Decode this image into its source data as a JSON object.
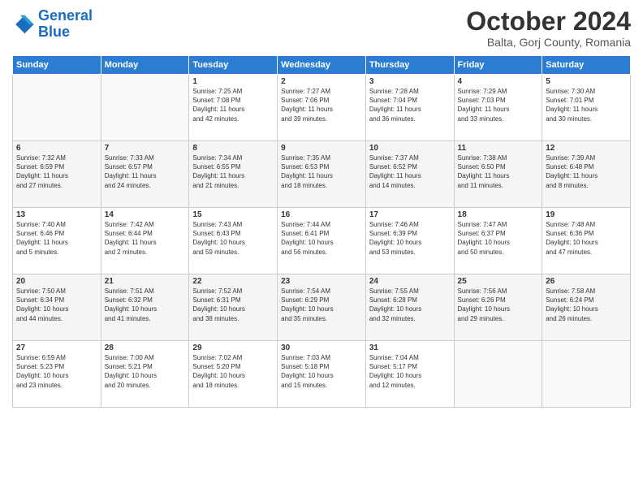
{
  "header": {
    "logo_line1": "General",
    "logo_line2": "Blue",
    "title": "October 2024",
    "subtitle": "Balta, Gorj County, Romania"
  },
  "days_of_week": [
    "Sunday",
    "Monday",
    "Tuesday",
    "Wednesday",
    "Thursday",
    "Friday",
    "Saturday"
  ],
  "weeks": [
    [
      {
        "day": "",
        "sunrise": "",
        "sunset": "",
        "daylight": ""
      },
      {
        "day": "",
        "sunrise": "",
        "sunset": "",
        "daylight": ""
      },
      {
        "day": "1",
        "sunrise": "Sunrise: 7:25 AM",
        "sunset": "Sunset: 7:08 PM",
        "daylight": "Daylight: 11 hours and 42 minutes."
      },
      {
        "day": "2",
        "sunrise": "Sunrise: 7:27 AM",
        "sunset": "Sunset: 7:06 PM",
        "daylight": "Daylight: 11 hours and 39 minutes."
      },
      {
        "day": "3",
        "sunrise": "Sunrise: 7:28 AM",
        "sunset": "Sunset: 7:04 PM",
        "daylight": "Daylight: 11 hours and 36 minutes."
      },
      {
        "day": "4",
        "sunrise": "Sunrise: 7:29 AM",
        "sunset": "Sunset: 7:03 PM",
        "daylight": "Daylight: 11 hours and 33 minutes."
      },
      {
        "day": "5",
        "sunrise": "Sunrise: 7:30 AM",
        "sunset": "Sunset: 7:01 PM",
        "daylight": "Daylight: 11 hours and 30 minutes."
      }
    ],
    [
      {
        "day": "6",
        "sunrise": "Sunrise: 7:32 AM",
        "sunset": "Sunset: 6:59 PM",
        "daylight": "Daylight: 11 hours and 27 minutes."
      },
      {
        "day": "7",
        "sunrise": "Sunrise: 7:33 AM",
        "sunset": "Sunset: 6:57 PM",
        "daylight": "Daylight: 11 hours and 24 minutes."
      },
      {
        "day": "8",
        "sunrise": "Sunrise: 7:34 AM",
        "sunset": "Sunset: 6:55 PM",
        "daylight": "Daylight: 11 hours and 21 minutes."
      },
      {
        "day": "9",
        "sunrise": "Sunrise: 7:35 AM",
        "sunset": "Sunset: 6:53 PM",
        "daylight": "Daylight: 11 hours and 18 minutes."
      },
      {
        "day": "10",
        "sunrise": "Sunrise: 7:37 AM",
        "sunset": "Sunset: 6:52 PM",
        "daylight": "Daylight: 11 hours and 14 minutes."
      },
      {
        "day": "11",
        "sunrise": "Sunrise: 7:38 AM",
        "sunset": "Sunset: 6:50 PM",
        "daylight": "Daylight: 11 hours and 11 minutes."
      },
      {
        "day": "12",
        "sunrise": "Sunrise: 7:39 AM",
        "sunset": "Sunset: 6:48 PM",
        "daylight": "Daylight: 11 hours and 8 minutes."
      }
    ],
    [
      {
        "day": "13",
        "sunrise": "Sunrise: 7:40 AM",
        "sunset": "Sunset: 6:46 PM",
        "daylight": "Daylight: 11 hours and 5 minutes."
      },
      {
        "day": "14",
        "sunrise": "Sunrise: 7:42 AM",
        "sunset": "Sunset: 6:44 PM",
        "daylight": "Daylight: 11 hours and 2 minutes."
      },
      {
        "day": "15",
        "sunrise": "Sunrise: 7:43 AM",
        "sunset": "Sunset: 6:43 PM",
        "daylight": "Daylight: 10 hours and 59 minutes."
      },
      {
        "day": "16",
        "sunrise": "Sunrise: 7:44 AM",
        "sunset": "Sunset: 6:41 PM",
        "daylight": "Daylight: 10 hours and 56 minutes."
      },
      {
        "day": "17",
        "sunrise": "Sunrise: 7:46 AM",
        "sunset": "Sunset: 6:39 PM",
        "daylight": "Daylight: 10 hours and 53 minutes."
      },
      {
        "day": "18",
        "sunrise": "Sunrise: 7:47 AM",
        "sunset": "Sunset: 6:37 PM",
        "daylight": "Daylight: 10 hours and 50 minutes."
      },
      {
        "day": "19",
        "sunrise": "Sunrise: 7:48 AM",
        "sunset": "Sunset: 6:36 PM",
        "daylight": "Daylight: 10 hours and 47 minutes."
      }
    ],
    [
      {
        "day": "20",
        "sunrise": "Sunrise: 7:50 AM",
        "sunset": "Sunset: 6:34 PM",
        "daylight": "Daylight: 10 hours and 44 minutes."
      },
      {
        "day": "21",
        "sunrise": "Sunrise: 7:51 AM",
        "sunset": "Sunset: 6:32 PM",
        "daylight": "Daylight: 10 hours and 41 minutes."
      },
      {
        "day": "22",
        "sunrise": "Sunrise: 7:52 AM",
        "sunset": "Sunset: 6:31 PM",
        "daylight": "Daylight: 10 hours and 38 minutes."
      },
      {
        "day": "23",
        "sunrise": "Sunrise: 7:54 AM",
        "sunset": "Sunset: 6:29 PM",
        "daylight": "Daylight: 10 hours and 35 minutes."
      },
      {
        "day": "24",
        "sunrise": "Sunrise: 7:55 AM",
        "sunset": "Sunset: 6:28 PM",
        "daylight": "Daylight: 10 hours and 32 minutes."
      },
      {
        "day": "25",
        "sunrise": "Sunrise: 7:56 AM",
        "sunset": "Sunset: 6:26 PM",
        "daylight": "Daylight: 10 hours and 29 minutes."
      },
      {
        "day": "26",
        "sunrise": "Sunrise: 7:58 AM",
        "sunset": "Sunset: 6:24 PM",
        "daylight": "Daylight: 10 hours and 26 minutes."
      }
    ],
    [
      {
        "day": "27",
        "sunrise": "Sunrise: 6:59 AM",
        "sunset": "Sunset: 5:23 PM",
        "daylight": "Daylight: 10 hours and 23 minutes."
      },
      {
        "day": "28",
        "sunrise": "Sunrise: 7:00 AM",
        "sunset": "Sunset: 5:21 PM",
        "daylight": "Daylight: 10 hours and 20 minutes."
      },
      {
        "day": "29",
        "sunrise": "Sunrise: 7:02 AM",
        "sunset": "Sunset: 5:20 PM",
        "daylight": "Daylight: 10 hours and 18 minutes."
      },
      {
        "day": "30",
        "sunrise": "Sunrise: 7:03 AM",
        "sunset": "Sunset: 5:18 PM",
        "daylight": "Daylight: 10 hours and 15 minutes."
      },
      {
        "day": "31",
        "sunrise": "Sunrise: 7:04 AM",
        "sunset": "Sunset: 5:17 PM",
        "daylight": "Daylight: 10 hours and 12 minutes."
      },
      {
        "day": "",
        "sunrise": "",
        "sunset": "",
        "daylight": ""
      },
      {
        "day": "",
        "sunrise": "",
        "sunset": "",
        "daylight": ""
      }
    ]
  ]
}
